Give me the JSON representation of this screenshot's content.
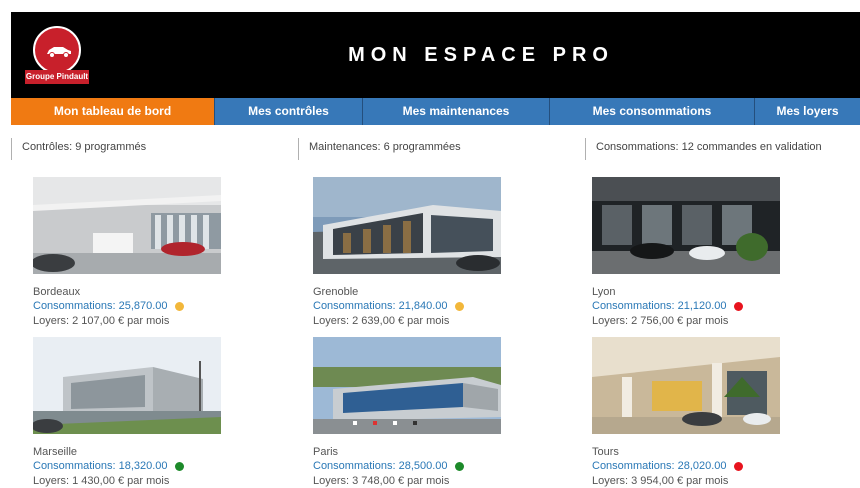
{
  "header": {
    "title": "MON ESPACE PRO",
    "logo_text": "Groupe Pindault"
  },
  "nav": {
    "tabs": [
      {
        "label": "Mon tableau de bord",
        "active": true
      },
      {
        "label": "Mes contrôles",
        "active": false
      },
      {
        "label": "Mes maintenances",
        "active": false
      },
      {
        "label": "Mes consommations",
        "active": false
      },
      {
        "label": "Mes loyers",
        "active": false
      }
    ]
  },
  "summary": {
    "controles": "Contrôles: 9 programmés",
    "maintenances": "Maintenances: 6 programmées",
    "consommations": "Consommations: 12 commandes en validation"
  },
  "colors": {
    "header_bg": "#000000",
    "nav_bg": "#3778b8",
    "nav_active": "#f07a12",
    "link": "#2a78b6",
    "status_yellow": "#f2b73a",
    "status_red": "#e8141e",
    "status_green": "#1d8a2a"
  },
  "sites": [
    {
      "name": "Bordeaux",
      "consommations": "Consommations: 25,870.00",
      "status": "yellow",
      "loyers": "Loyers: 2 107,00 € par mois"
    },
    {
      "name": "Grenoble",
      "consommations": "Consommations: 21,840.00",
      "status": "yellow",
      "loyers": "Loyers: 2 639,00 € par mois"
    },
    {
      "name": "Lyon",
      "consommations": "Consommations: 21,120.00",
      "status": "red",
      "loyers": "Loyers: 2 756,00 € par mois"
    },
    {
      "name": "Marseille",
      "consommations": "Consommations: 18,320.00",
      "status": "green",
      "loyers": "Loyers: 1 430,00 € par mois"
    },
    {
      "name": "Paris",
      "consommations": "Consommations: 28,500.00",
      "status": "green",
      "loyers": "Loyers: 3 748,00 € par mois"
    },
    {
      "name": "Tours",
      "consommations": "Consommations: 28,020.00",
      "status": "red",
      "loyers": "Loyers: 3 954,00 € par mois"
    }
  ]
}
